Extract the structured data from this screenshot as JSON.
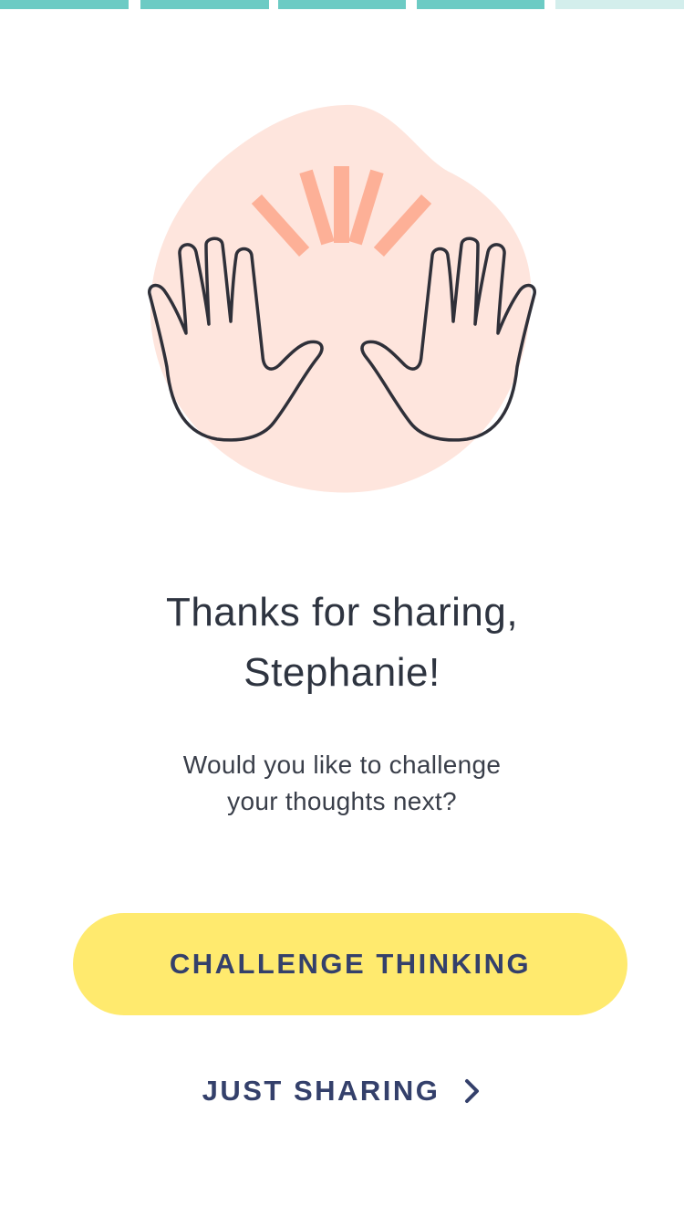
{
  "progress": {
    "total_steps": 5,
    "completed_steps": 4,
    "colors": {
      "completed": "#6ccbc4",
      "remaining": "#d3eeec"
    }
  },
  "illustration": {
    "icon": "raised-hands-icon",
    "colors": {
      "blob": "#fee5dd",
      "rays": "#fdb097",
      "outline": "#2f3039"
    }
  },
  "message": {
    "title_line1": "Thanks for sharing,",
    "title_line2": "Stephanie!",
    "subtitle_line1": "Would you like to challenge",
    "subtitle_line2": "your thoughts next?"
  },
  "actions": {
    "primary_label": "CHALLENGE THINKING",
    "primary_color": "#ffea6e",
    "secondary_label": "JUST SHARING",
    "secondary_icon": "chevron-right-icon",
    "text_color": "#34406b"
  }
}
